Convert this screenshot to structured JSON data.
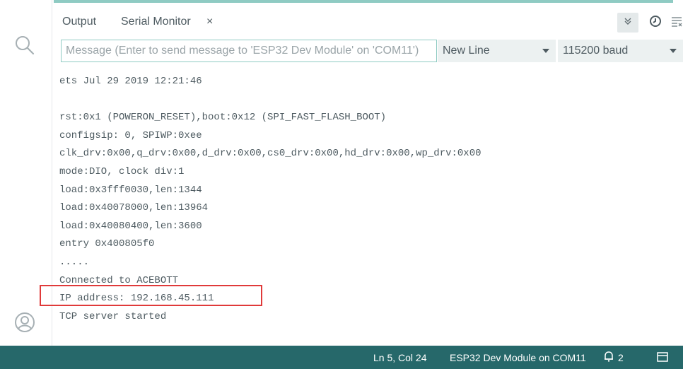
{
  "panel": {
    "tabs": [
      {
        "label": "Output"
      },
      {
        "label": "Serial Monitor"
      }
    ],
    "close_glyph": "×",
    "actions": [
      "double-chevron-down-icon",
      "clock-icon",
      "clear-output-icon"
    ]
  },
  "toolbar": {
    "message_placeholder": "Message (Enter to send message to 'ESP32 Dev Module' on 'COM11')",
    "line_ending": "New Line",
    "baud_rate": "115200 baud"
  },
  "console": {
    "lines": [
      "ets Jul 29 2019 12:21:46",
      "",
      "rst:0x1 (POWERON_RESET),boot:0x12 (SPI_FAST_FLASH_BOOT)",
      "configsip: 0, SPIWP:0xee",
      "clk_drv:0x00,q_drv:0x00,d_drv:0x00,cs0_drv:0x00,hd_drv:0x00,wp_drv:0x00",
      "mode:DIO, clock div:1",
      "load:0x3fff0030,len:1344",
      "load:0x40078000,len:13964",
      "load:0x40080400,len:3600",
      "entry 0x400805f0",
      ".....",
      "Connected to ACEBOTT",
      "IP address: 192.168.45.111",
      "TCP server started"
    ]
  },
  "statusbar": {
    "cursor_position": "Ln 5, Col 24",
    "board_port": "ESP32 Dev Module on COM11",
    "notification_count": "2"
  },
  "colors": {
    "accent": "#8fcbc3",
    "statusbar_bg": "#26686a",
    "highlight": "#e03a3a"
  }
}
